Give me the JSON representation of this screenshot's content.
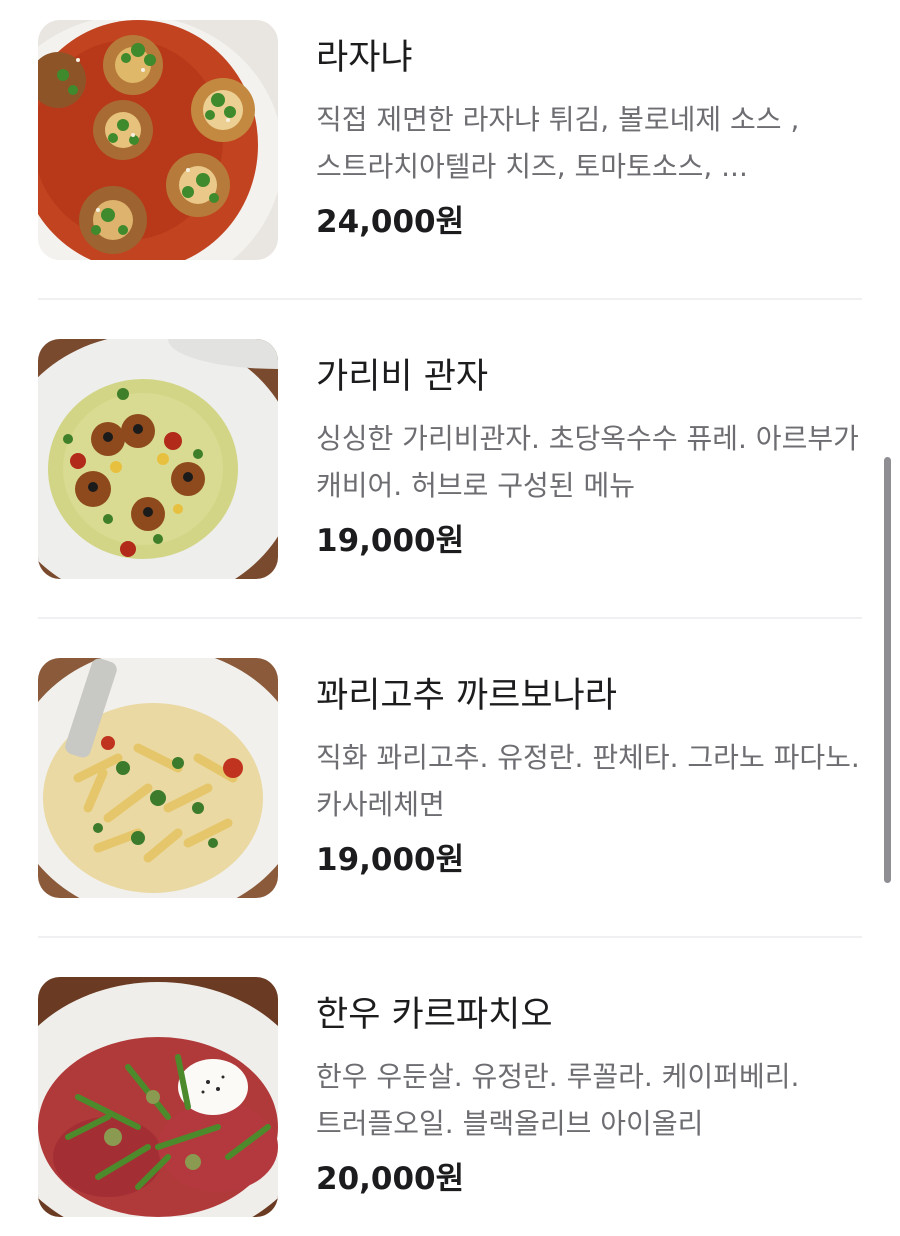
{
  "menu": {
    "items": [
      {
        "name": "라자냐",
        "description": "직접 제면한 라자냐 튀김, 볼로네제 소스 , 스트라치아텔라 치즈, 토마토소스, ...",
        "price": "24,000원"
      },
      {
        "name": "가리비 관자",
        "description": "싱싱한 가리비관자. 초당옥수수 퓨레. 아르부가 캐비어. 허브로 구성된 메뉴",
        "price": "19,000원"
      },
      {
        "name": "꽈리고추 까르보나라",
        "description": "직화 꽈리고추. 유정란. 판체타. 그라노 파다노. 카사레체면",
        "price": "19,000원"
      },
      {
        "name": "한우 카르파치오",
        "description": "한우 우둔살. 유정란. 루꼴라. 케이퍼베리. 트러플오일. 블랙올리브 아이올리",
        "price": "20,000원"
      }
    ]
  },
  "colors": {
    "text_primary": "#1c1c1e",
    "text_secondary": "#6d6d72",
    "divider": "#f0f0f2",
    "scrollbar": "#8e8e93"
  }
}
